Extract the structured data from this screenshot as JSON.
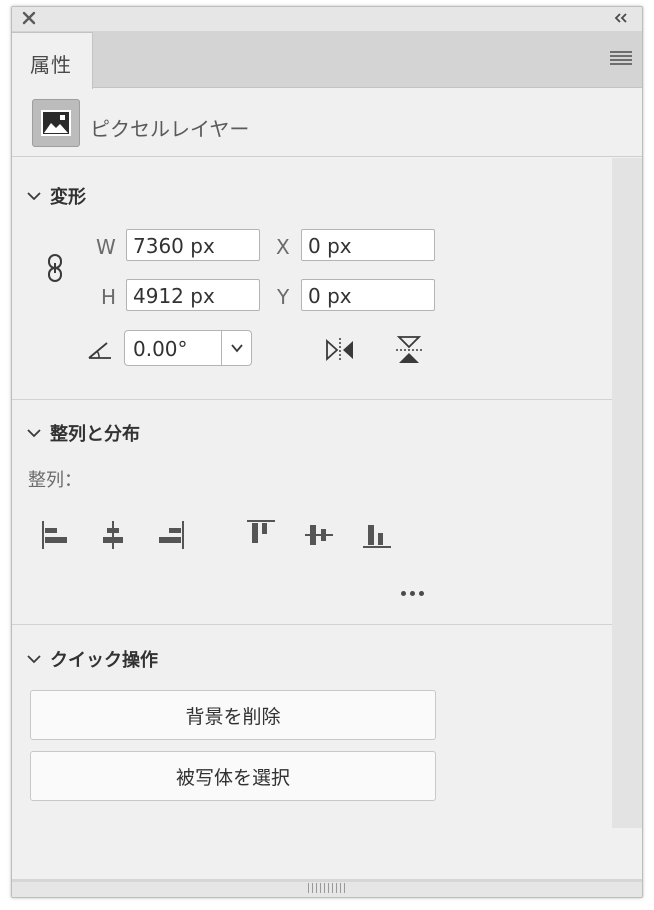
{
  "panel": {
    "tab_label": "属性",
    "layer_type": "ピクセルレイヤー"
  },
  "transform": {
    "title": "変形",
    "w_label": "W",
    "w_value": "7360 px",
    "x_label": "X",
    "x_value": "0 px",
    "h_label": "H",
    "h_value": "4912 px",
    "y_label": "Y",
    "y_value": "0 px",
    "angle_value": "0.00°"
  },
  "align": {
    "title": "整列と分布",
    "label": "整列："
  },
  "quick_actions": {
    "title": "クイック操作",
    "remove_background": "背景を削除",
    "select_subject": "被写体を選択"
  },
  "icons": {
    "close": "close-icon",
    "collapse": "double-chevron-left-icon",
    "menu": "hamburger-menu-icon",
    "layer": "pixel-layer-thumbnail-icon",
    "link": "chain-link-icon",
    "angle": "angle-icon",
    "flip_h": "flip-horizontal-icon",
    "flip_v": "flip-vertical-icon"
  },
  "colors": {
    "panel_bg": "#f0f0f0",
    "tab_strip": "#d4d4d4",
    "text": "#323232",
    "input_border": "#b4b4b4"
  }
}
